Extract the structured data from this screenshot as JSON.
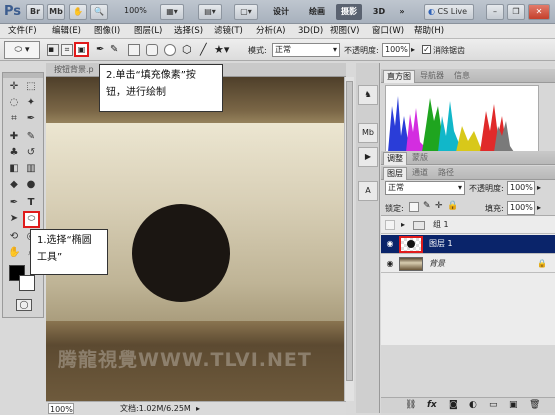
{
  "titlebar": {
    "app_logo": "Ps",
    "zoom": "100%",
    "workspaces": [
      "设计",
      "绘画",
      "摄影",
      "3D"
    ],
    "more": "»",
    "cslive": "CS Live"
  },
  "menubar": {
    "items": [
      "文件(F)",
      "编辑(E)",
      "图像(I)",
      "图层(L)",
      "选择(S)",
      "滤镜(T)",
      "分析(A)",
      "3D(D)",
      "视图(V)",
      "窗口(W)",
      "帮助(H)"
    ]
  },
  "options": {
    "mode_label": "模式:",
    "mode_value": "正常",
    "opacity_label": "不透明度:",
    "opacity_value": "100%",
    "antialias_label": "消除锯齿"
  },
  "document": {
    "tab_title": "按钮背景.p",
    "zoom": "100%",
    "doc_info": "文档:1.02M/6.25M"
  },
  "watermark": "腾龍視覺WWW.TLVI.NET",
  "callouts": {
    "step2_line1": "2.单击“填充像素”按",
    "step2_line2": "钮，进行绘制",
    "step1_line1": "1.选择“椭圆",
    "step1_line2": "工具”"
  },
  "panels": {
    "top_tabs": [
      "直方图",
      "导航器",
      "信息"
    ],
    "adjust_tabs": [
      "调整",
      "蒙版"
    ],
    "layer_tabs": [
      "图层",
      "通道",
      "路径"
    ],
    "blend_mode": "正常",
    "opacity_label": "不透明度:",
    "opacity_value": "100%",
    "lock_label": "锁定:",
    "fill_label": "填充:",
    "fill_value": "100%",
    "layers": [
      {
        "name": "组 1"
      },
      {
        "name": "图层 1"
      },
      {
        "name": "背景"
      }
    ]
  },
  "colors": {
    "selection_blue": "#0a246a",
    "highlight_red": "#e01b1b",
    "circle": "#1b1612"
  }
}
